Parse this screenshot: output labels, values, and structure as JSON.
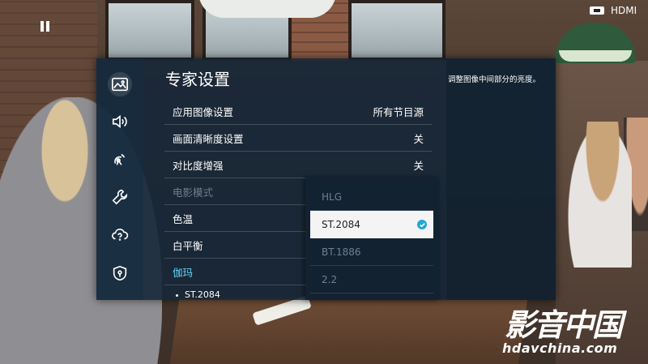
{
  "status": {
    "input_source": "HDMI"
  },
  "panel": {
    "title": "专家设置",
    "description": "调整图像中间部分的亮度。",
    "sidebar_icons": [
      "picture-icon",
      "sound-icon",
      "broadcast-icon",
      "wrench-icon",
      "support-icon",
      "privacy-shield-icon"
    ],
    "rows": [
      {
        "label": "应用图像设置",
        "value": "所有节目源"
      },
      {
        "label": "画面清晰度设置",
        "value": "关"
      },
      {
        "label": "对比度增强",
        "value": "关"
      },
      {
        "label": "电影模式",
        "value": ""
      },
      {
        "label": "色温",
        "value": ""
      },
      {
        "label": "白平衡",
        "value": ""
      },
      {
        "label": "伽玛",
        "value": ""
      }
    ],
    "sub_item": "ST.2084"
  },
  "dropdown": {
    "options": [
      "HLG",
      "ST.2084",
      "BT.1886",
      "2.2"
    ],
    "selected": "ST.2084"
  },
  "watermark": {
    "brand": "影音中国",
    "url": "hdavchina.com"
  }
}
